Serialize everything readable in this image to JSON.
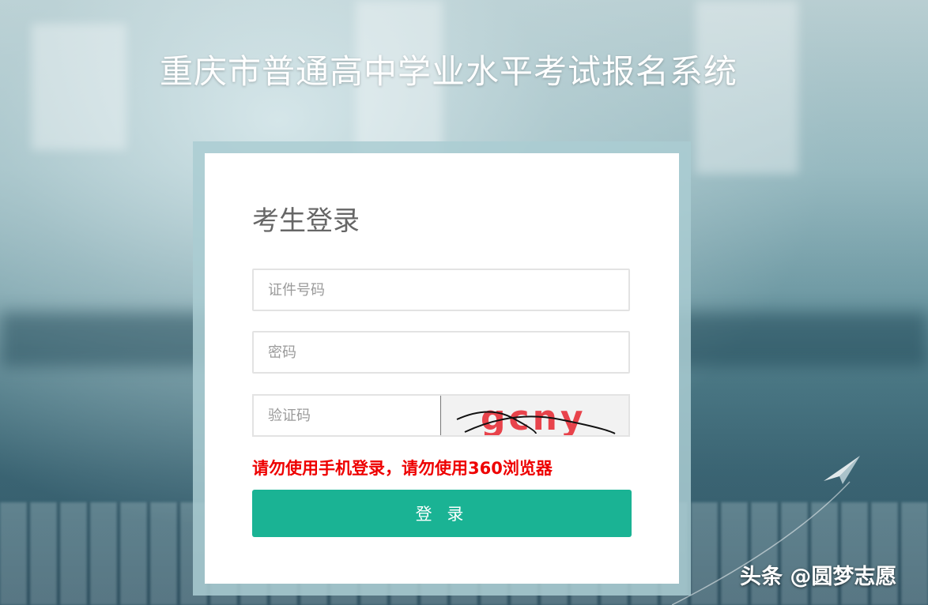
{
  "site": {
    "title": "重庆市普通高中学业水平考试报名系统"
  },
  "login": {
    "heading": "考生登录",
    "id_placeholder": "证件号码",
    "password_placeholder": "密码",
    "captcha_placeholder": "验证码",
    "captcha_text": "gcny",
    "warning": "请勿使用手机登录，请勿使用360浏览器",
    "submit_label": "登 录"
  },
  "watermark": {
    "text": "头条 @圆梦志愿"
  },
  "colors": {
    "accent": "#1ab394",
    "warning": "#ee0000",
    "captcha_text": "#e8313a"
  }
}
